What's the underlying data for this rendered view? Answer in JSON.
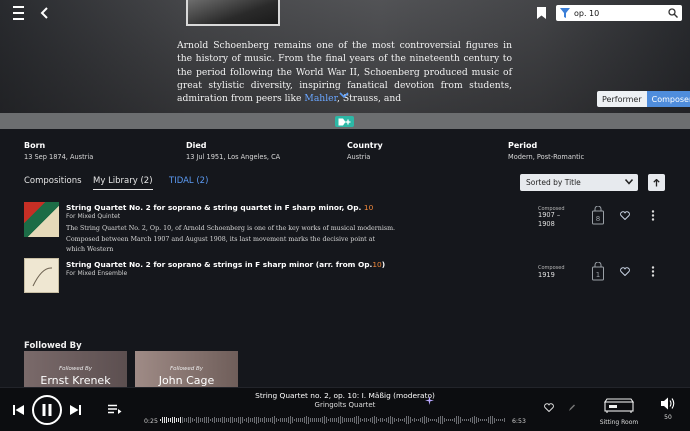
{
  "search": {
    "value": "op. 10"
  },
  "bio": {
    "text": "Arnold Schoenberg remains one of the most controversial figures in the history of music. From the final years of the nineteenth century to the period following the World War II, Schoenberg produced music of great stylistic diversity, inspiring fanatical devotion from students, admiration from peers like ",
    "link": "Mahler",
    "tail": ", Strauss, and"
  },
  "role_toggle": {
    "performer": "Performer",
    "composer": "Composer"
  },
  "facts": [
    {
      "key": "Born",
      "value": "13 Sep 1874, Austria"
    },
    {
      "key": "Died",
      "value": "13 Jul 1951, Los Angeles, CA"
    },
    {
      "key": "Country",
      "value": "Austria"
    },
    {
      "key": "Period",
      "value": "Modern,  Post-Romantic"
    }
  ],
  "tabs": [
    {
      "label": "Compositions"
    },
    {
      "label": "My Library (2)"
    },
    {
      "label": "TIDAL (2)"
    }
  ],
  "sort": {
    "label": "Sorted by Title"
  },
  "works": [
    {
      "title": "String Quartet No. 2 for soprano & string quartet in F sharp minor, Op. ",
      "highlight": "10",
      "title_tail": "",
      "form": "For Mixed Quintet",
      "desc": "The String Quartet No. 2, Op. 10, of Arnold Schoenberg is one of the key works of musical modernism. Composed between March 1907 and August 1908, its last movement marks the decisive point at which Western",
      "composed_label": "Composed",
      "composed_value": "1907 –\n1908",
      "library_count": "8"
    },
    {
      "title": "String Quartet No. 2 for soprano & strings in F sharp minor (arr. from Op.",
      "highlight": "10",
      "title_tail": ")",
      "form": "For Mixed Ensemble",
      "desc": "",
      "composed_label": "Composed",
      "composed_value": "1919",
      "library_count": "1"
    }
  ],
  "followed_by": {
    "label": "Followed By",
    "items": [
      {
        "caption": "Followed By",
        "name": "Ernst Krenek"
      },
      {
        "caption": "Followed By",
        "name": "John Cage"
      }
    ]
  },
  "player": {
    "title": "String Quartet no. 2, op. 10: I. Mäßig (moderato)",
    "artist": "Gringolts Quartet",
    "elapsed": "0:25",
    "duration": "6:53",
    "progress": 0.063,
    "zone": "Sitting Room",
    "volume": "50"
  }
}
